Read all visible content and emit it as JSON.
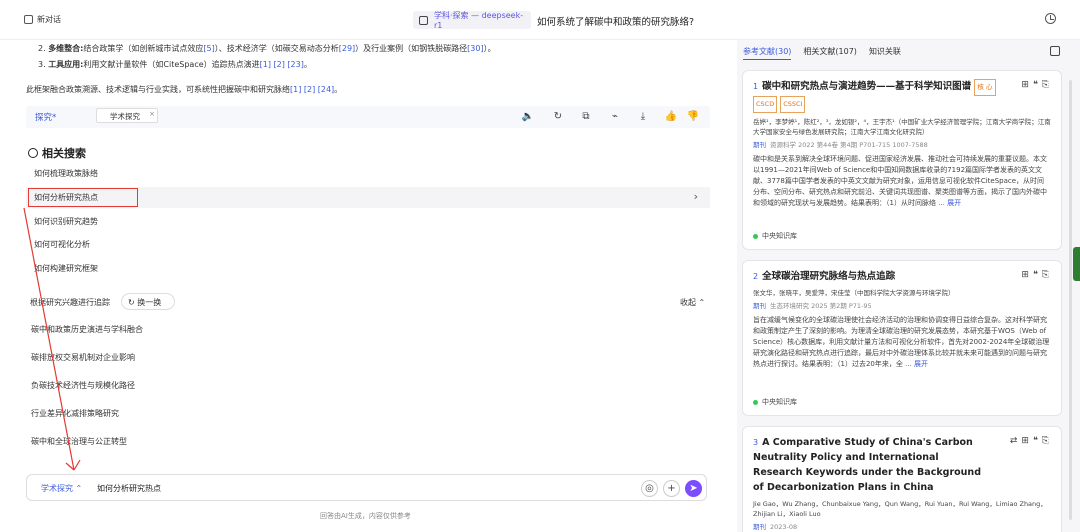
{
  "header": {
    "new_chat": "新对话",
    "model": "学科·探索 — deepseek-r1",
    "question": "如何系统了解碳中和政策的研究脉络?"
  },
  "answer": {
    "line1": {
      "num": "2.",
      "bold": "多维整合:",
      "text": "结合政策学（如创新城市试点效应",
      "ref1": "[5]",
      "text2": "）、技术经济学（如碳交易动态分析",
      "ref2": "[29]",
      "text3": "）及行业案例（如钢铁脱碳路径",
      "ref3": "[30]",
      "text4": "）。"
    },
    "line2": {
      "num": "3.",
      "bold": "工具应用:",
      "text": "利用文献计量软件（如CiteSpace）追踪热点演进",
      "refs": "[1] [2] [23]",
      "end": "。"
    },
    "summary": "此框架融合政策溯源、技术逻辑与行业实践，可系统性把握碳中和研究脉络",
    "summary_refs": "[1] [2] [24]",
    "summary_end": "。"
  },
  "actionbar": {
    "tanjiu": "探究*",
    "mode_box": "学术探究",
    "mode_box_close": "×",
    "icons": [
      "speaker-icon",
      "regenerate-icon",
      "copy-icon",
      "share-icon",
      "download-icon",
      "thumbs-up-icon",
      "thumbs-down-icon"
    ]
  },
  "related": {
    "title": "相关搜索",
    "items": [
      "如何梳理政策脉络",
      "如何分析研究热点",
      "如何识别研究趋势",
      "如何可视化分析",
      "如何构建研究框架"
    ],
    "follow_label": "根据研究兴趣进行追踪",
    "refresh": "换一换",
    "collapse": "收起",
    "follow_items": [
      "碳中和政策历史演进与学科融合",
      "碳排放权交易机制对企业影响",
      "负碳技术经济性与规模化路径",
      "行业差异化减排策略研究",
      "碳中和全球治理与公正转型"
    ]
  },
  "input": {
    "mode": "学术探究",
    "text": "如何分析研究热点",
    "disclaimer": "回答由AI生成，内容仅供参考"
  },
  "right": {
    "tabs": [
      "参考文献(30)",
      "相关文献(107)",
      "知识关联"
    ],
    "cards": [
      {
        "num": "1",
        "title": "碳中和研究热点与演进趋势——基于科学知识图谱",
        "tag_title": "核 心",
        "tags": [
          "CSCD",
          "CSSCI"
        ],
        "authors": "岳婷¹，李梦婷¹，陈红²，³，龙如银²，⁴，王宇杰¹（中国矿业大学经济管理学院；江南大学商学院；江南大学国家安全与绿色发展研究院；江南大学江南文化研究院）",
        "journal_label": "期刊",
        "journal": "资源科学 2022 第44卷 第4期 P701-715 1007-7588",
        "abstract": "碳中和是关系到解决全球环境问题、促进国家经济发展、推动社会可持续发展的重要议题。本文以1991—2021年间Web of Science和中国知网数据库收录的7192篇国际学者发表的英文文献、3778篇中国学者发表的中英文文献为研究对象，运用信息可视化软件CiteSpace，从时间分布、空间分布、研究热点和研究前沿、关键词共现图谱、聚类图谱等方面，揭示了国内外碳中和领域的研究现状与发展趋势。结果表明：（1）从时间脉络",
        "more": "... 展开",
        "source": "中央知识库"
      },
      {
        "num": "2",
        "title": "全球碳治理研究脉络与热点追踪",
        "authors": "张文华，张晓平，吴爱萍，宋佳莹（中国科学院大学资源与环境学院）",
        "journal_label": "期刊",
        "journal": "生态环境研究 2025 第2期 P71-95",
        "abstract": "旨在减缓气候变化的全球碳治理使社会经济活动的治理和协调变得日益综合复杂。这对科学研究和政策制定产生了深刻的影响。为理清全球碳治理的研究发展态势，本研究基于WOS（Web of Science）核心数据库，利用文献计量方法和可视化分析软件，首先对2002-2024年全球碳治理研究演化路径和研究热点进行追踪，最后对中外碳治理体系比较并就未来可能遇到的问题与研究热点进行探讨。结果表明：（1）过去20年来，全",
        "more": "... 展开",
        "source": "中央知识库"
      },
      {
        "num": "3",
        "title": "A Comparative Study of China's Carbon Neutrality Policy and International Research Keywords under the Background of Decarbonization Plans in China",
        "authors": "Jie Gao，Wu Zhang，Chunbaixue Yang，Qun Wang，Rui Yuan，Rui Wang，Limiao Zhang，Zhijian Li，Xiaoli Luo",
        "journal_label": "期刊",
        "journal": "2023-08"
      }
    ]
  }
}
